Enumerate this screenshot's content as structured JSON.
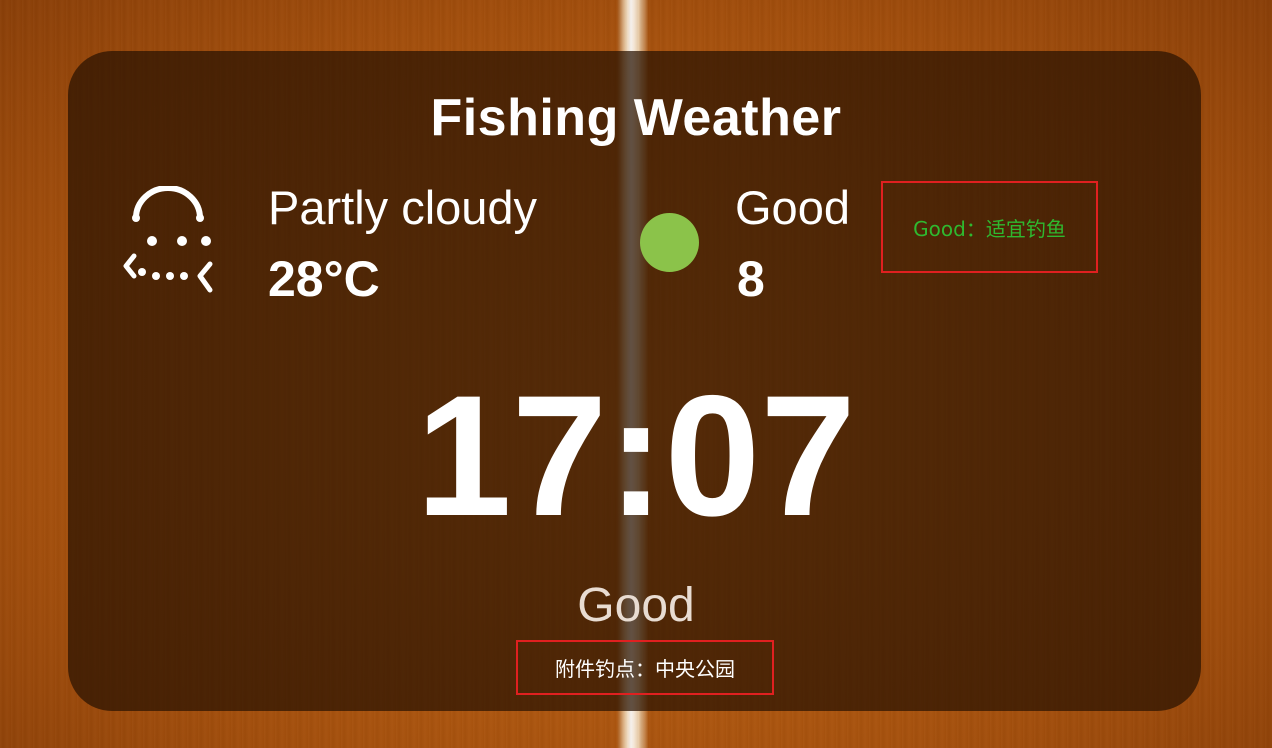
{
  "app": {
    "title": "Fishing Weather"
  },
  "weather": {
    "condition": "Partly cloudy",
    "temperature": "28°C",
    "icon": "partly-cloudy-icon"
  },
  "rating": {
    "label": "Good",
    "score": "8",
    "indicator_color": "#8bc34a"
  },
  "advice": {
    "text": "Good：适宜钓鱼",
    "text_color": "#2fb82f"
  },
  "clock": {
    "time": "17:07"
  },
  "status": {
    "label": "Good"
  },
  "spot": {
    "text": "附件钓点：中央公园"
  },
  "colors": {
    "highlight_border": "#e02020",
    "background_accent": "#b85e12"
  }
}
